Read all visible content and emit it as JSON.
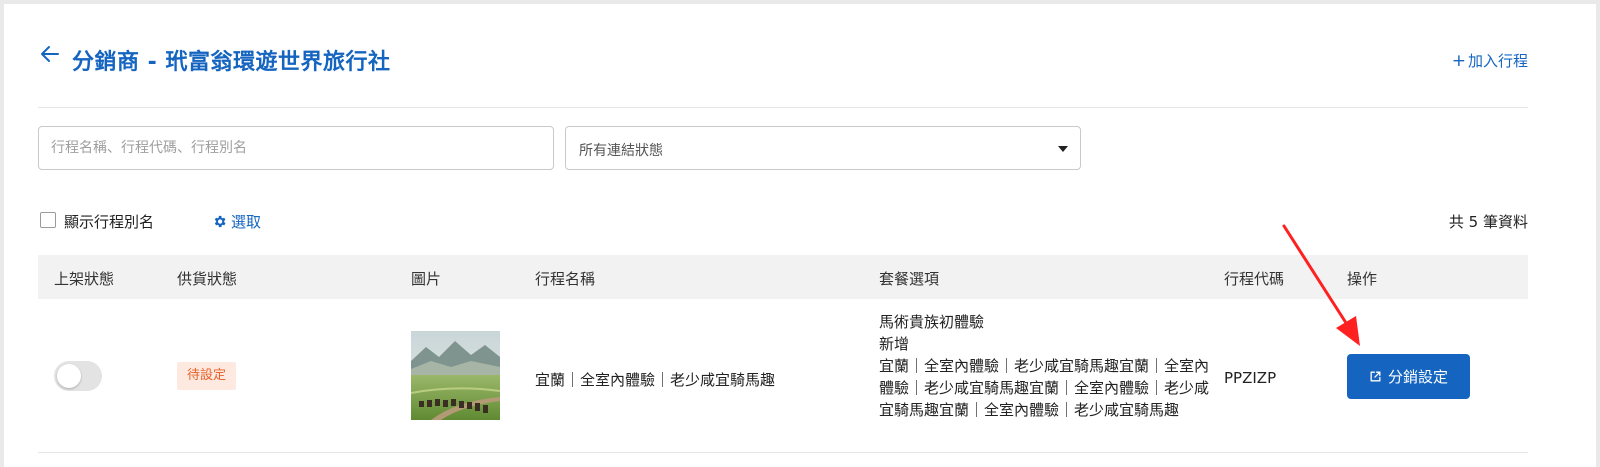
{
  "header": {
    "title": "分銷商 - 玳富翁環遊世界旅行社",
    "add_label": "加入行程"
  },
  "filters": {
    "search_placeholder": "行程名稱、行程代碼、行程別名",
    "status_select_value": "所有連結狀態"
  },
  "tools": {
    "show_alias_label": "顯示行程別名",
    "select_label": "選取",
    "count_label": "共 5 筆資料"
  },
  "table": {
    "columns": [
      "上架狀態",
      "供貨狀態",
      "圖片",
      "行程名稱",
      "套餐選項",
      "行程代碼",
      "操作"
    ],
    "rows": [
      {
        "listed": false,
        "supply_status": "待設定",
        "trip_name": "宜蘭｜全室內體驗｜老少咸宜騎馬趣",
        "packages": [
          "馬術貴族初體驗",
          "新增",
          "宜蘭｜全室內體驗｜老少咸宜騎馬趣宜蘭｜全室內體驗｜老少咸宜騎馬趣宜蘭｜全室內體驗｜老少咸宜騎馬趣宜蘭｜全室內體驗｜老少咸宜騎馬趣"
        ],
        "code": "PPZIZP",
        "action_label": "分銷設定"
      }
    ]
  },
  "colors": {
    "accent": "#1565c0",
    "badge_bg": "#fde9df",
    "badge_text": "#e8622a",
    "annotation": "#ff2020"
  }
}
